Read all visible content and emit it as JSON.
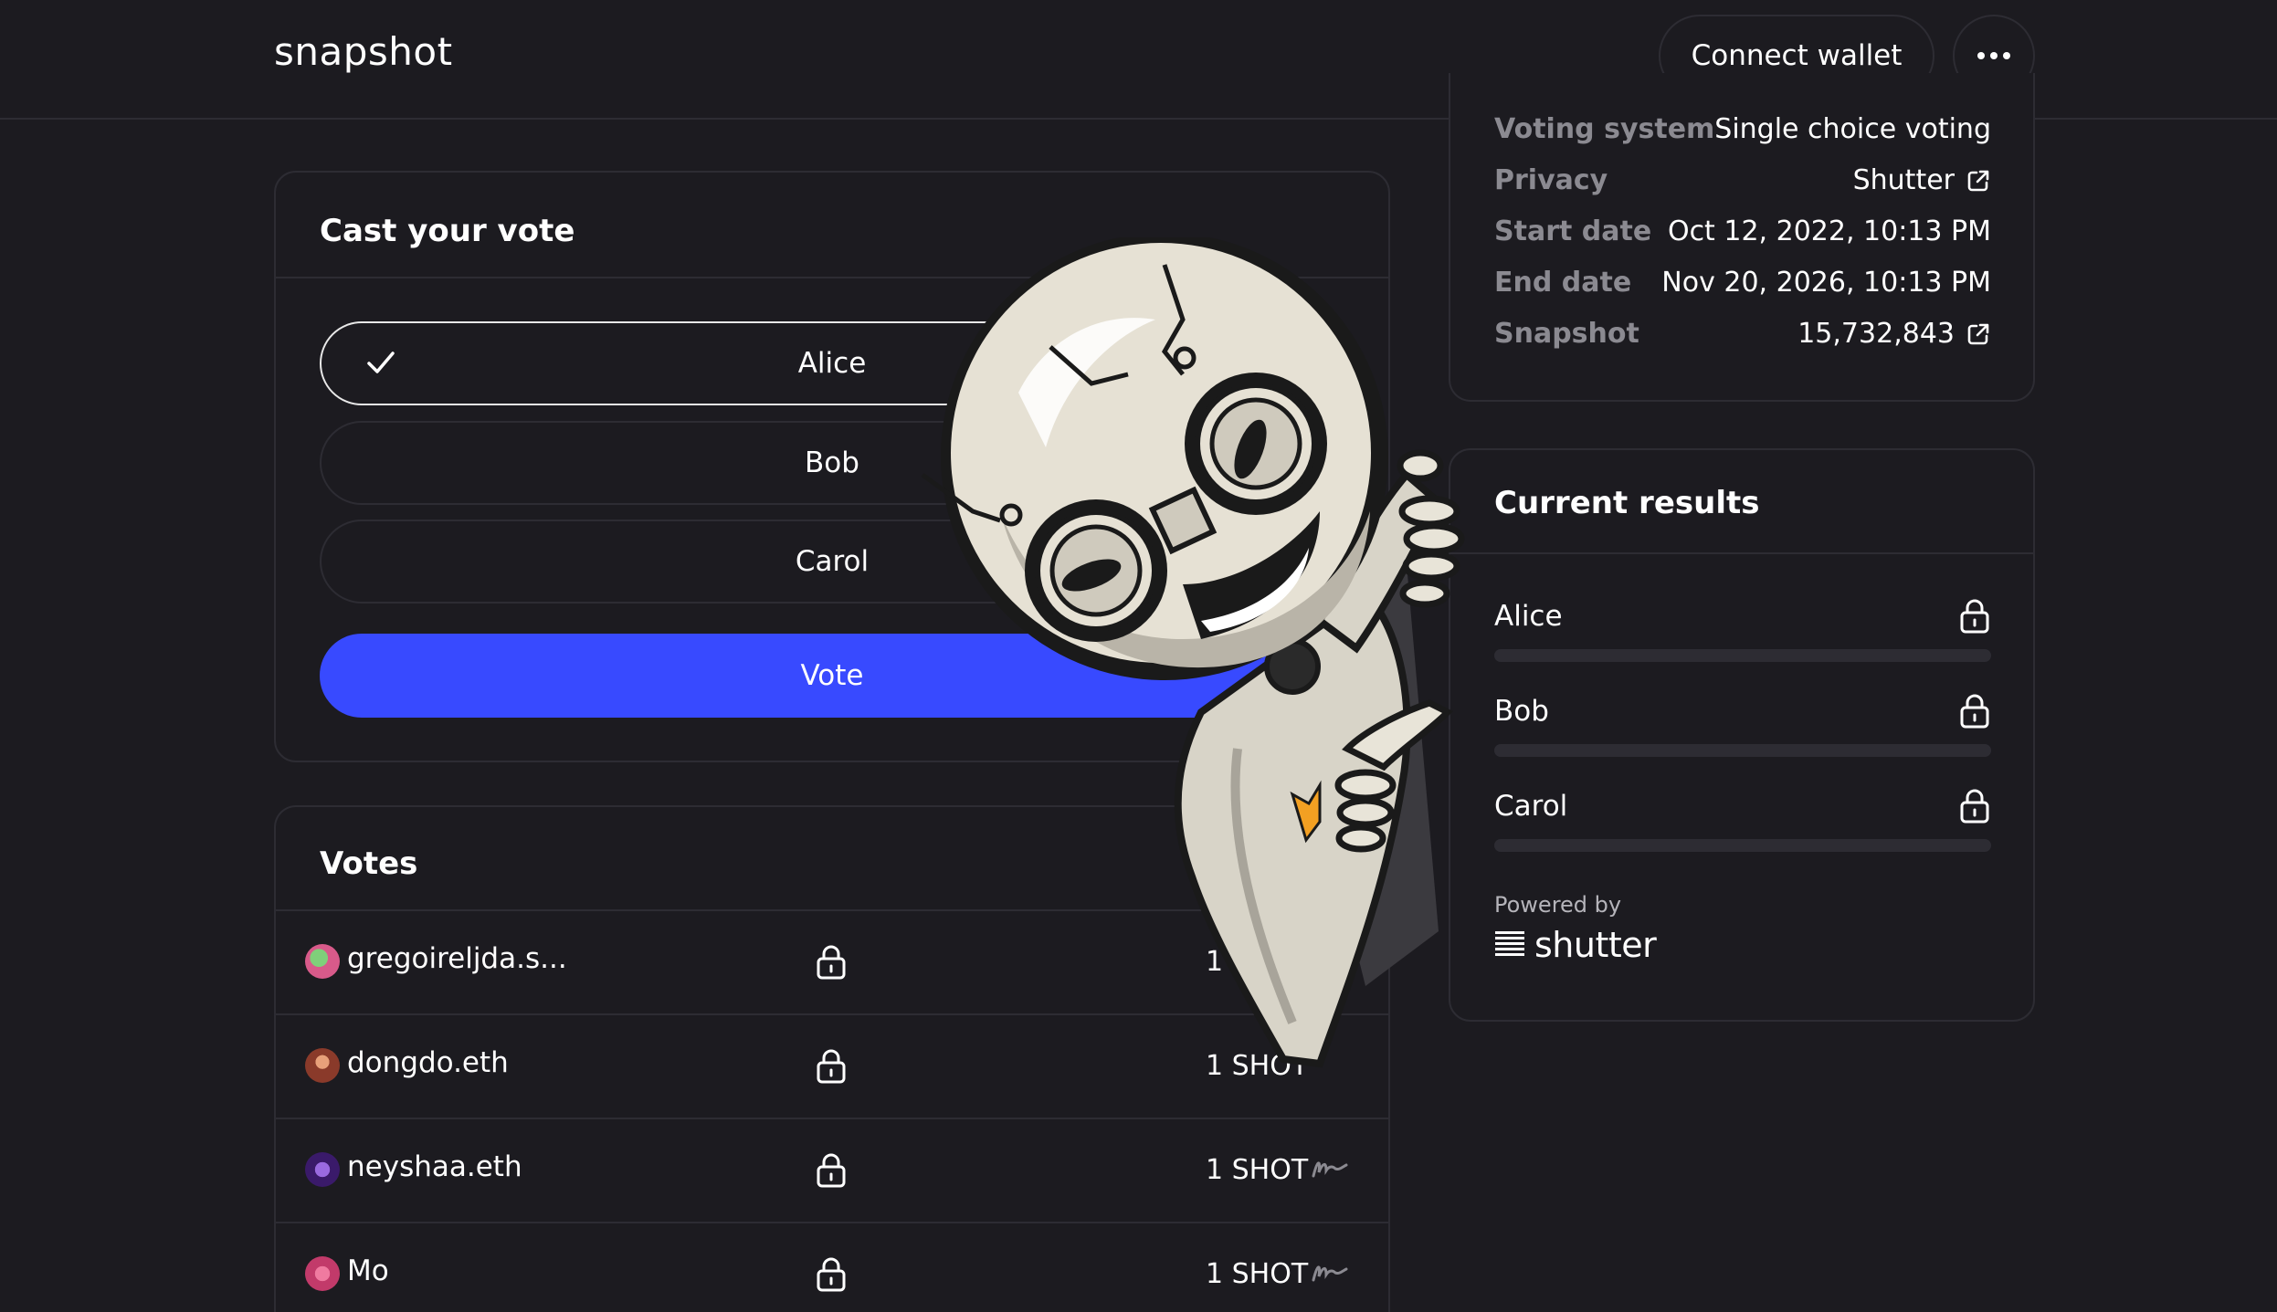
{
  "header": {
    "logo": "snapshot",
    "connect_wallet": "Connect wallet"
  },
  "cast_vote": {
    "title": "Cast your vote",
    "choices": [
      "Alice",
      "Bob",
      "Carol"
    ],
    "selected_index": 0,
    "vote_button": "Vote"
  },
  "votes": {
    "title": "Votes",
    "rows": [
      {
        "voter": "gregoireljda.s...",
        "amount": "1 SH",
        "avatar_color": "#d85a8a"
      },
      {
        "voter": "dongdo.eth",
        "amount": "1 SHOT",
        "avatar_color": "#b06a4a"
      },
      {
        "voter": "neyshaa.eth",
        "amount": "1 SHOT",
        "avatar_color": "#6a3aa8"
      },
      {
        "voter": "Mo",
        "amount": "1 SHOT",
        "avatar_color": "#c23a6a"
      }
    ]
  },
  "info": {
    "rows": [
      {
        "label": "Voting system",
        "value": "Single choice voting",
        "external_link": false
      },
      {
        "label": "Privacy",
        "value": "Shutter",
        "external_link": true
      },
      {
        "label": "Start date",
        "value": "Oct 12, 2022, 10:13 PM",
        "external_link": false
      },
      {
        "label": "End date",
        "value": "Nov 20, 2026, 10:13 PM",
        "external_link": false
      },
      {
        "label": "Snapshot",
        "value": "15,732,843",
        "external_link": true
      }
    ]
  },
  "results": {
    "title": "Current results",
    "items": [
      "Alice",
      "Bob",
      "Carol"
    ],
    "powered_by": "Powered by",
    "brand": "shutter"
  },
  "colors": {
    "background": "#1c1b20",
    "border": "#2d2c33",
    "primary": "#384aff",
    "muted_text": "#8b8a91"
  }
}
